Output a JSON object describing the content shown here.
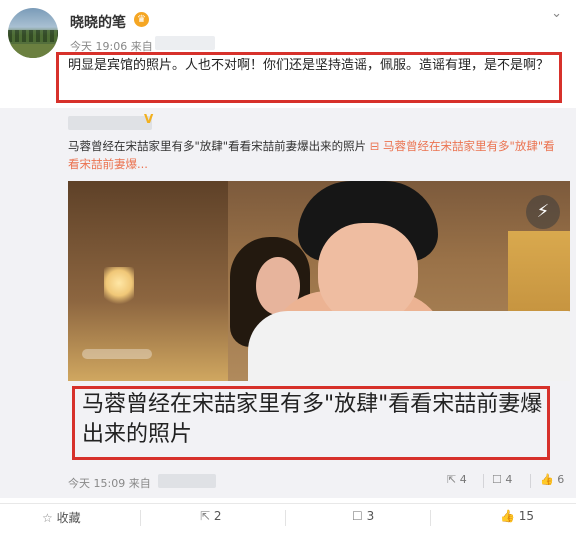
{
  "header": {
    "username": "晓晓的笔",
    "vip_icon": "crown-badge-icon",
    "time": "今天 19:06 来自",
    "menu_icon": "chevron-down-icon"
  },
  "post": {
    "text": "明显是宾馆的照片。人也不对啊！你们还是坚持造谣，佩服。造谣有理，是不是啊？"
  },
  "quoted": {
    "verified_mark": "V",
    "text": "马蓉曾经在宋喆家里有多\"放肆\"看看宋喆前妻爆出来的照片",
    "link_label": "马蓉曾经在宋喆家里有多\"放肆\"看看宋喆前妻爆...",
    "caption": "马蓉曾经在宋喆家里有多\"放肆\"看看宋喆前妻爆出来的照片",
    "time": "今天 15:09 来自",
    "repost_count": "4",
    "comment_count": "4",
    "like_count": "6"
  },
  "actions": {
    "favorite_label": "收藏",
    "repost_count": "2",
    "comment_count": "3",
    "like_count": "15"
  },
  "colors": {
    "accent_red": "#d7312b",
    "link": "#eb7350",
    "vip": "#f5a623"
  }
}
